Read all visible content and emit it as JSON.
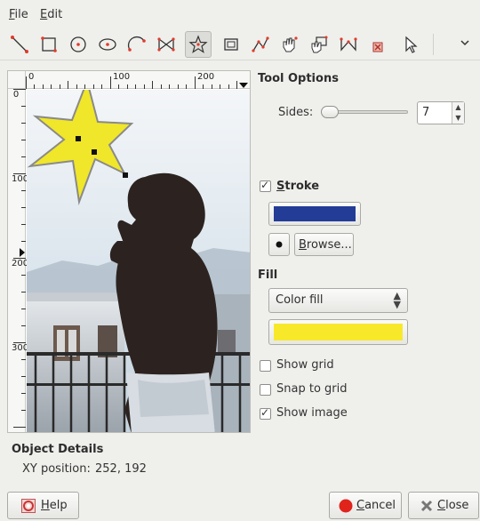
{
  "menu": {
    "file": "File",
    "edit": "Edit"
  },
  "toolbar": {
    "tools": [
      "line-tool-icon",
      "rectangle-tool-icon",
      "circle-tool-icon",
      "ellipse-tool-icon",
      "arc-tool-icon",
      "bowtie-tool-icon",
      "star-tool-icon",
      "frame-tool-icon",
      "path-tool-icon",
      "hand-node-tool-icon",
      "move-node-tool-icon",
      "node-add-tool-icon",
      "node-delete-tool-icon",
      "selection-arrow-icon"
    ],
    "active_tool": "star-tool-icon"
  },
  "canvas": {
    "hruler_labels": [
      "0",
      "100",
      "200"
    ],
    "vruler_labels": [
      "0",
      "100",
      "200",
      "300"
    ]
  },
  "tool_options": {
    "title": "Tool Options",
    "sides_label": "Sides:",
    "sides_value": "7",
    "sides_slider_level": 0.05
  },
  "stroke": {
    "label": "Stroke",
    "checked": true,
    "color": "#233c96",
    "browse_label": "Browse..."
  },
  "fill": {
    "title": "Fill",
    "selected": "Color fill",
    "color": "#f7e92a",
    "show_grid": {
      "label": "Show grid",
      "checked": false
    },
    "snap_to_grid": {
      "label": "Snap to grid",
      "checked": false
    },
    "show_image": {
      "label": "Show image",
      "checked": true
    }
  },
  "object_details": {
    "title": "Object Details",
    "xy_label": "XY position:",
    "xy_value": "252, 192"
  },
  "footer": {
    "help": "Help",
    "cancel": "Cancel",
    "close": "Close"
  }
}
